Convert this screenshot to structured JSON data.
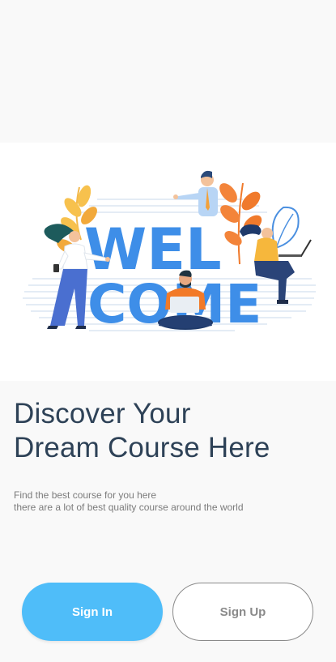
{
  "hero": {
    "illustration_icon": "welcome-illustration",
    "banner_text": [
      "WEL",
      "COME"
    ]
  },
  "headline": {
    "line1": "Discover Your",
    "line2": "Dream Course Here"
  },
  "subtext": {
    "line1": "Find the best course for you here",
    "line2": "there are a lot of best quality course around the world"
  },
  "actions": {
    "sign_in_label": "Sign In",
    "sign_up_label": "Sign Up"
  },
  "colors": {
    "background": "#f9f9f9",
    "headline": "#2e4257",
    "primary_button": "#4fbdf9",
    "secondary_border": "#8a8a8a"
  }
}
